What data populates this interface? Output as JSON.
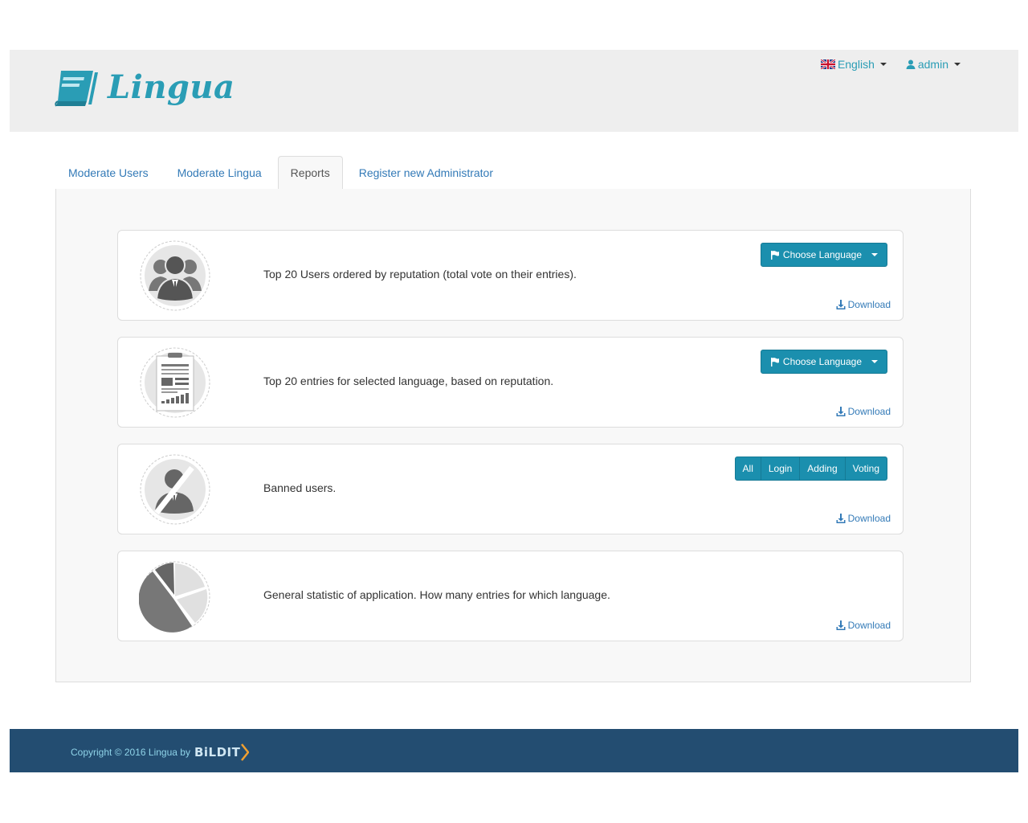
{
  "header": {
    "brand": "Lingua",
    "language_menu": {
      "label": "English"
    },
    "user_menu": {
      "label": "admin"
    }
  },
  "tabs": [
    {
      "label": "Moderate Users"
    },
    {
      "label": "Moderate Lingua"
    },
    {
      "label": "Reports",
      "active": true
    },
    {
      "label": "Register new Administrator"
    }
  ],
  "reports": [
    {
      "text": "Top 20 Users ordered by reputation (total vote on their entries).",
      "button": "Choose Language",
      "download": "Download"
    },
    {
      "text": "Top 20 entries for selected language, based on reputation.",
      "button": "Choose Language",
      "download": "Download"
    },
    {
      "text": "Banned users.",
      "filters": [
        "All",
        "Login",
        "Adding",
        "Voting"
      ],
      "download": "Download"
    },
    {
      "text": "General statistic of application. How many entries for which language.",
      "download": "Download"
    }
  ],
  "footer": {
    "copyright": "Copyright © 2016 Lingua by",
    "company_logo_text": "BiLDIT"
  },
  "colors": {
    "accent": "#2a9db5",
    "button": "#1b8fae",
    "footer_bg": "#234d71",
    "link": "#337ab7"
  }
}
